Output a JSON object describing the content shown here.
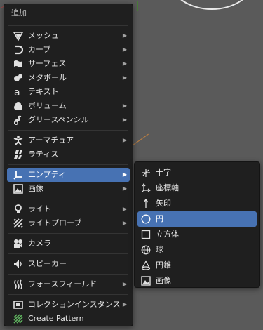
{
  "menu": {
    "title": "追加",
    "items": [
      {
        "label": "メッシュ",
        "icon": "mesh-icon",
        "arrow": "▶"
      },
      {
        "label": "カーブ",
        "icon": "curve-icon",
        "arrow": "▶"
      },
      {
        "label": "サーフェス",
        "icon": "surface-icon",
        "arrow": "▶"
      },
      {
        "label": "メタボール",
        "icon": "metaball-icon",
        "arrow": "▶"
      },
      {
        "label": "テキスト",
        "icon": "text-icon",
        "arrow": ""
      },
      {
        "label": "ボリューム",
        "icon": "volume-icon",
        "arrow": "▶"
      },
      {
        "label": "グリースペンシル",
        "icon": "grease-pencil-icon",
        "arrow": "▶"
      },
      {
        "label": "アーマチュア",
        "icon": "armature-icon",
        "arrow": "▶"
      },
      {
        "label": "ラティス",
        "icon": "lattice-icon",
        "arrow": ""
      },
      {
        "label": "エンプティ",
        "icon": "empty-icon",
        "arrow": "▶"
      },
      {
        "label": "画像",
        "icon": "image-icon",
        "arrow": "▶"
      },
      {
        "label": "ライト",
        "icon": "light-icon",
        "arrow": "▶"
      },
      {
        "label": "ライトプローブ",
        "icon": "light-probe-icon",
        "arrow": "▶"
      },
      {
        "label": "カメラ",
        "icon": "camera-icon",
        "arrow": ""
      },
      {
        "label": "スピーカー",
        "icon": "speaker-icon",
        "arrow": ""
      },
      {
        "label": "フォースフィールド",
        "icon": "force-field-icon",
        "arrow": "▶"
      },
      {
        "label": "コレクションインスタンス",
        "icon": "collection-icon",
        "arrow": "▶"
      },
      {
        "label": "Create Pattern",
        "icon": "pattern-icon",
        "arrow": ""
      }
    ]
  },
  "submenu": {
    "items": [
      {
        "label": "十字",
        "icon": "plain-axes-icon"
      },
      {
        "label": "座標軸",
        "icon": "arrows-icon"
      },
      {
        "label": "矢印",
        "icon": "single-arrow-icon"
      },
      {
        "label": "円",
        "icon": "circle-icon"
      },
      {
        "label": "立方体",
        "icon": "cube-icon"
      },
      {
        "label": "球",
        "icon": "sphere-icon"
      },
      {
        "label": "円錐",
        "icon": "cone-icon"
      },
      {
        "label": "画像",
        "icon": "image-icon"
      }
    ]
  },
  "colors": {
    "highlight": "#4772b3",
    "menu_bg": "#1f1f1f"
  }
}
